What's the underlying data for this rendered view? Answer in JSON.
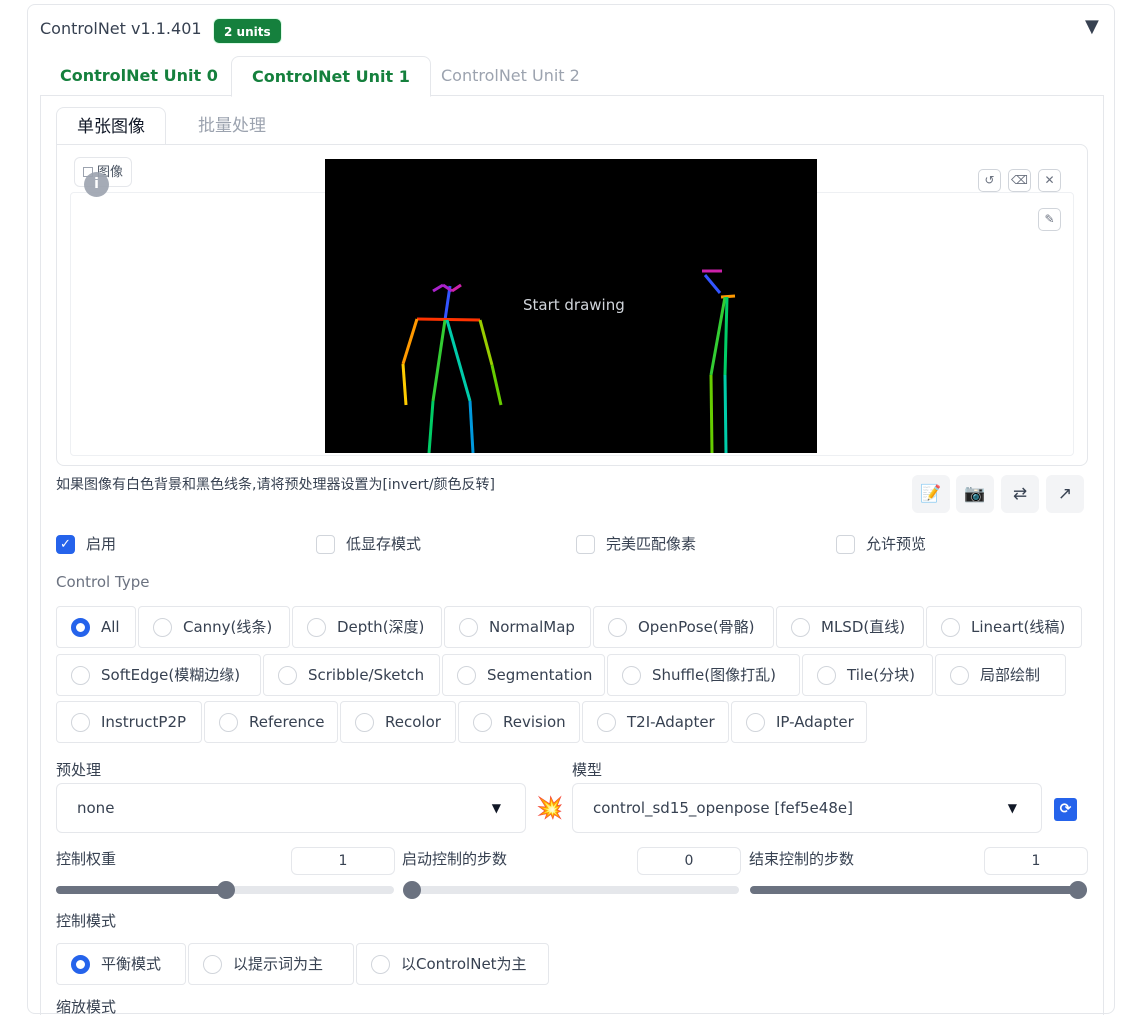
{
  "header": {
    "title": "ControlNet v1.1.401",
    "badge": "2 units",
    "collapse_icon": "triangle-down-icon"
  },
  "unit_tabs": [
    {
      "label": "ControlNet Unit 0",
      "state": "inactive-green"
    },
    {
      "label": "ControlNet Unit 1",
      "state": "active"
    },
    {
      "label": "ControlNet Unit 2",
      "state": "inactive"
    }
  ],
  "image_tabs": [
    {
      "label": "单张图像",
      "active": true
    },
    {
      "label": "批量处理",
      "active": false
    }
  ],
  "canvas": {
    "image_label": "图像",
    "overlay_text": "Start drawing",
    "buttons": [
      "undo-icon",
      "eraser-icon",
      "close-icon",
      "brush-icon"
    ]
  },
  "invert_hint": "如果图像有白色背景和黑色线条,请将预处理器设置为[invert/颜色反转]",
  "tools": [
    "edit-icon",
    "camera-icon",
    "swap-icon",
    "send-icon"
  ],
  "options": {
    "enable": {
      "label": "启用",
      "checked": true
    },
    "low_vram": {
      "label": "低显存模式",
      "checked": false
    },
    "pixel_perfect": {
      "label": "完美匹配像素",
      "checked": false
    },
    "allow_preview": {
      "label": "允许预览",
      "checked": false
    }
  },
  "control_type": {
    "label": "Control Type",
    "selected": "All",
    "rows": [
      [
        "All",
        "Canny(线条)",
        "Depth(深度)",
        "NormalMap",
        "OpenPose(骨骼)",
        "MLSD(直线)",
        "Lineart(线稿)"
      ],
      [
        "SoftEdge(模糊边缘)",
        "Scribble/Sketch",
        "Segmentation",
        "Shuffle(图像打乱)",
        "Tile(分块)",
        "局部绘制"
      ],
      [
        "InstructP2P",
        "Reference",
        "Recolor",
        "Revision",
        "T2I-Adapter",
        "IP-Adapter"
      ]
    ]
  },
  "preprocessor": {
    "label": "预处理",
    "value": "none"
  },
  "model": {
    "label": "模型",
    "value": "control_sd15_openpose [fef5e48e]"
  },
  "sliders": {
    "weight": {
      "label": "控制权重",
      "value": "1",
      "fraction": 0.5
    },
    "start": {
      "label": "启动控制的步数",
      "value": "0",
      "fraction": 0.0
    },
    "end": {
      "label": "结束控制的步数",
      "value": "1",
      "fraction": 1.0
    }
  },
  "control_mode": {
    "label": "控制模式",
    "selected": "平衡模式",
    "options": [
      "平衡模式",
      "以提示词为主",
      "以ControlNet为主"
    ]
  },
  "resize_mode_label": "缩放模式",
  "colors": {
    "accent": "#2563eb",
    "brand_green": "#15803d"
  }
}
